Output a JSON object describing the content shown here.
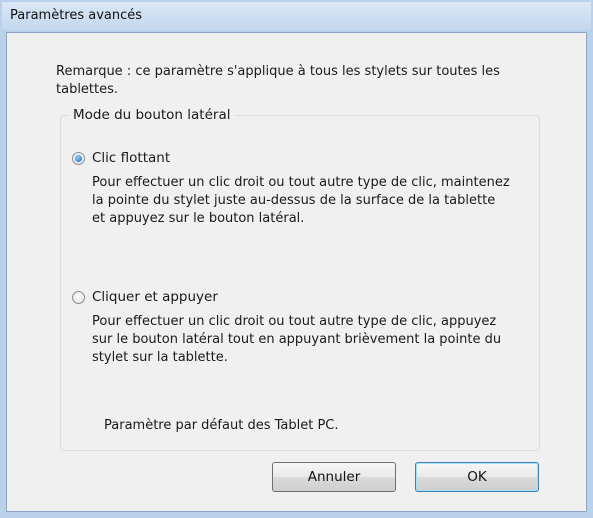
{
  "window": {
    "title": "Paramètres avancés"
  },
  "note": "Remarque : ce paramètre s'applique à tous les stylets sur toutes les tablettes.",
  "group": {
    "legend": "Mode du bouton latéral"
  },
  "options": [
    {
      "label": "Clic flottant",
      "checked": true,
      "description": "Pour effectuer un clic droit ou tout autre type de clic, maintenez la pointe du stylet juste au-dessus de la surface de la tablette et appuyez sur le bouton latéral."
    },
    {
      "label": "Cliquer et appuyer",
      "checked": false,
      "description": "Pour effectuer un clic droit ou tout autre type de clic, appuyez sur le bouton latéral tout en appuyant brièvement la pointe du stylet sur la tablette."
    }
  ],
  "default_note": "Paramètre par défaut des Tablet PC.",
  "buttons": {
    "cancel": "Annuler",
    "ok": "OK"
  }
}
